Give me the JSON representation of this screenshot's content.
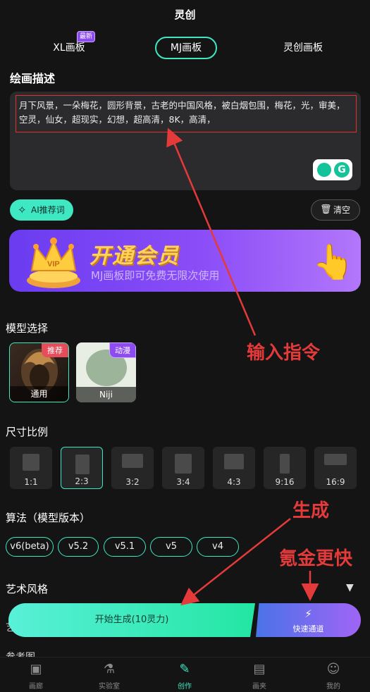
{
  "app": {
    "title": "灵创"
  },
  "tabs": [
    {
      "label": "XL画板",
      "badge": "最新"
    },
    {
      "label": "MJ画板"
    },
    {
      "label": "灵创画板"
    }
  ],
  "description": {
    "title": "绘画描述",
    "text": "月下风景，一朵梅花，圆形背景，古老的中国风格，被白烟包围，梅花，光，审美，空灵，仙女，超现实，幻想，超高清，8K，高清，"
  },
  "buttons": {
    "ai_prompt": "AI推荐词",
    "clear": "清空"
  },
  "vip_banner": {
    "title": "开通会员",
    "subtitle": "MJ画板即可免费无限次使用"
  },
  "model": {
    "title": "模型选择",
    "cards": [
      {
        "label": "通用",
        "tag": "推荐"
      },
      {
        "label": "Niji",
        "tag": "动漫"
      }
    ]
  },
  "ratio": {
    "title": "尺寸比例",
    "options": [
      "1:1",
      "2:3",
      "3:2",
      "3:4",
      "4:3",
      "9:16",
      "16:9"
    ],
    "selected": "2:3"
  },
  "algorithm": {
    "title": "算法（模型版本）",
    "versions": [
      "v6(beta)",
      "v5.2",
      "v5.1",
      "v5",
      "v4"
    ]
  },
  "style": {
    "title": "艺术风格"
  },
  "peek": {
    "line1": "艺",
    "line2": "参考图"
  },
  "generate": {
    "label": "开始生成(10灵力)",
    "fast_label": "快速通道"
  },
  "nav": [
    {
      "label": "画廊",
      "icon": "image-icon"
    },
    {
      "label": "实验室",
      "icon": "flask-icon"
    },
    {
      "label": "创作",
      "icon": "create-icon"
    },
    {
      "label": "画夹",
      "icon": "folder-icon"
    },
    {
      "label": "我的",
      "icon": "profile-icon"
    }
  ],
  "annotations": {
    "input": "输入指令",
    "generate": "生成",
    "fast": "氪金更快"
  },
  "colors": {
    "accent": "#3ee8c3",
    "annotation": "#e53a3a",
    "background": "#141414"
  }
}
